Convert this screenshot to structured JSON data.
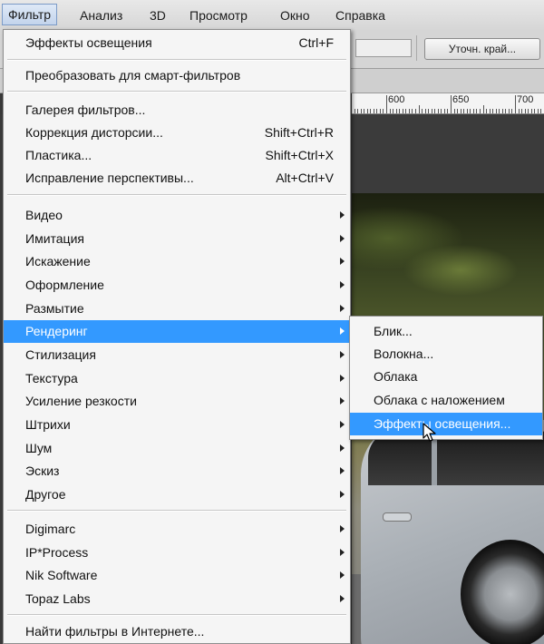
{
  "menubar": {
    "items": [
      {
        "label": "Фильтр",
        "active": true
      },
      {
        "label": "Анализ",
        "active": false
      },
      {
        "label": "3D",
        "active": false
      },
      {
        "label": "Просмотр",
        "active": false
      },
      {
        "label": "Окно",
        "active": false
      },
      {
        "label": "Справка",
        "active": false
      }
    ]
  },
  "options_bar": {
    "refine_button": "Уточн. край..."
  },
  "ruler": {
    "labels": [
      "600",
      "650",
      "700"
    ]
  },
  "filter_menu": {
    "items": [
      {
        "label": "Эффекты освещения",
        "shortcut": "Ctrl+F"
      },
      {
        "label": "Преобразовать для смарт-фильтров"
      },
      {
        "label": "Галерея фильтров..."
      },
      {
        "label": "Коррекция дисторсии...",
        "shortcut": "Shift+Ctrl+R"
      },
      {
        "label": "Пластика...",
        "shortcut": "Shift+Ctrl+X"
      },
      {
        "label": "Исправление перспективы...",
        "shortcut": "Alt+Ctrl+V"
      },
      {
        "label": "Видео",
        "submenu": true
      },
      {
        "label": "Имитация",
        "submenu": true
      },
      {
        "label": "Искажение",
        "submenu": true
      },
      {
        "label": "Оформление",
        "submenu": true
      },
      {
        "label": "Размытие",
        "submenu": true
      },
      {
        "label": "Рендеринг",
        "submenu": true,
        "highlighted": true
      },
      {
        "label": "Стилизация",
        "submenu": true
      },
      {
        "label": "Текстура",
        "submenu": true
      },
      {
        "label": "Усиление резкости",
        "submenu": true
      },
      {
        "label": "Штрихи",
        "submenu": true
      },
      {
        "label": "Шум",
        "submenu": true
      },
      {
        "label": "Эскиз",
        "submenu": true
      },
      {
        "label": "Другое",
        "submenu": true
      },
      {
        "label": "Digimarc",
        "submenu": true
      },
      {
        "label": "IP*Process",
        "submenu": true
      },
      {
        "label": "Nik Software",
        "submenu": true
      },
      {
        "label": "Topaz Labs",
        "submenu": true
      },
      {
        "label": "Найти фильтры в Интернете..."
      }
    ]
  },
  "render_submenu": {
    "items": [
      {
        "label": "Блик..."
      },
      {
        "label": "Волокна..."
      },
      {
        "label": "Облака"
      },
      {
        "label": "Облака с наложением"
      },
      {
        "label": "Эффекты освещения...",
        "highlighted": true
      }
    ]
  },
  "colors": {
    "highlight": "#3399ff",
    "menu_bg": "#f5f5f5"
  }
}
